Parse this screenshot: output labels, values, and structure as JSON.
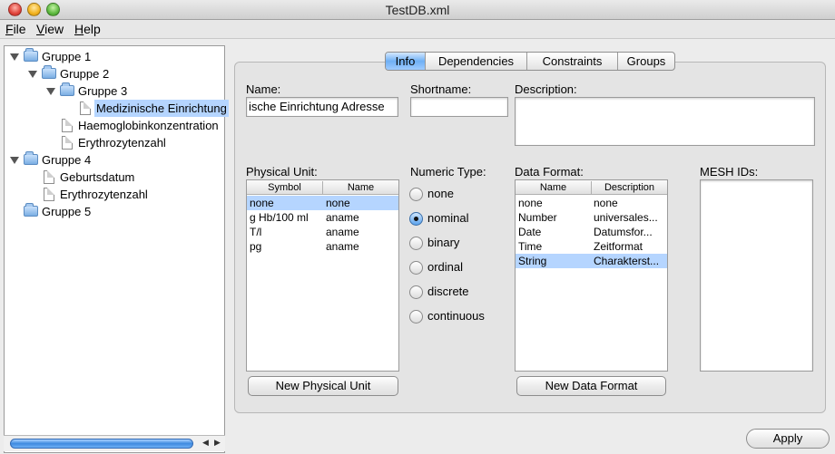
{
  "window": {
    "title": "TestDB.xml"
  },
  "menubar": [
    {
      "underline": "F",
      "rest": "ile"
    },
    {
      "underline": "V",
      "rest": "iew"
    },
    {
      "underline": "H",
      "rest": "elp"
    }
  ],
  "tree": {
    "gruppe1": "Gruppe 1",
    "gruppe2": "Gruppe 2",
    "gruppe3": "Gruppe 3",
    "medizinische": "Medizinische Einrichtung",
    "haemoglobin": "Haemoglobinkonzentration",
    "erythro1": "Erythrozytenzahl",
    "gruppe4": "Gruppe 4",
    "geburtsdatum": "Geburtsdatum",
    "erythro2": "Erythrozytenzahl",
    "gruppe5": "Gruppe 5"
  },
  "tabs": [
    "Info",
    "Dependencies",
    "Constraints",
    "Groups"
  ],
  "form": {
    "name_label": "Name:",
    "name_value": "ische Einrichtung Adresse",
    "shortname_label": "Shortname:",
    "shortname_value": "",
    "description_label": "Description:",
    "physical_unit_label": "Physical Unit:",
    "numeric_type_label": "Numeric Type:",
    "data_format_label": "Data Format:",
    "mesh_label": "MESH IDs:"
  },
  "physical_unit": {
    "headers": [
      "Symbol",
      "Name"
    ],
    "rows": [
      [
        "none",
        "none"
      ],
      [
        "g Hb/100 ml",
        "aname"
      ],
      [
        "T/l",
        "aname"
      ],
      [
        "pg",
        "aname"
      ]
    ]
  },
  "numeric_types": [
    "none",
    "nominal",
    "binary",
    "ordinal",
    "discrete",
    "continuous"
  ],
  "numeric_type_selected": "nominal",
  "data_format": {
    "headers": [
      "Name",
      "Description"
    ],
    "rows": [
      [
        "none",
        "none"
      ],
      [
        "Number",
        "universales..."
      ],
      [
        "Date",
        "Datumsfor..."
      ],
      [
        "Time",
        "Zeitformat"
      ],
      [
        "String",
        "Charakterst..."
      ]
    ]
  },
  "buttons": {
    "new_physical_unit": "New Physical Unit",
    "new_data_format": "New Data Format",
    "apply": "Apply"
  },
  "colors": {
    "selection": "#b5d5ff",
    "accent": "#6fb0f5"
  }
}
